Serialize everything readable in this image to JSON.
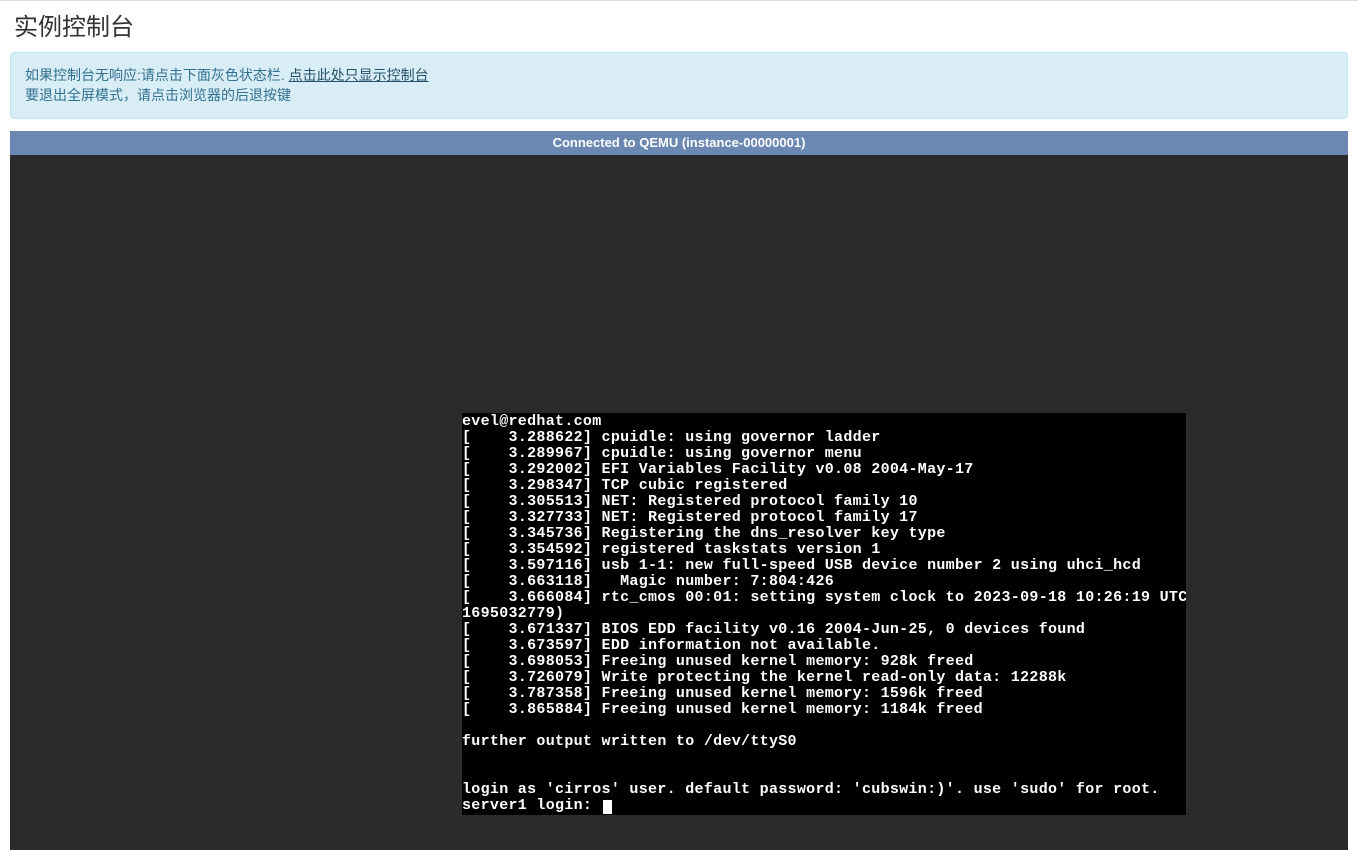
{
  "header": {
    "title": "实例控制台"
  },
  "alert": {
    "line1_pre": "如果控制台无响应:请点击下面灰色状态栏. ",
    "link": "点击此处只显示控制台",
    "line2": "要退出全屏模式，请点击浏览器的后退按键"
  },
  "status_bar": {
    "text": "Connected to QEMU (instance-00000001)"
  },
  "terminal": {
    "lines": [
      "evel@redhat.com",
      "[    3.288622] cpuidle: using governor ladder",
      "[    3.289967] cpuidle: using governor menu",
      "[    3.292002] EFI Variables Facility v0.08 2004-May-17",
      "[    3.298347] TCP cubic registered",
      "[    3.305513] NET: Registered protocol family 10",
      "[    3.327733] NET: Registered protocol family 17",
      "[    3.345736] Registering the dns_resolver key type",
      "[    3.354592] registered taskstats version 1",
      "[    3.597116] usb 1-1: new full-speed USB device number 2 using uhci_hcd",
      "[    3.663118]   Magic number: 7:804:426",
      "[    3.666084] rtc_cmos 00:01: setting system clock to 2023-09-18 10:26:19 UTC (",
      "1695032779)",
      "[    3.671337] BIOS EDD facility v0.16 2004-Jun-25, 0 devices found",
      "[    3.673597] EDD information not available.",
      "[    3.698053] Freeing unused kernel memory: 928k freed",
      "[    3.726079] Write protecting the kernel read-only data: 12288k",
      "[    3.787358] Freeing unused kernel memory: 1596k freed",
      "[    3.865884] Freeing unused kernel memory: 1184k freed",
      "",
      "further output written to /dev/ttyS0",
      "",
      "",
      "login as 'cirros' user. default password: 'cubswin:)'. use 'sudo' for root.",
      "server1 login: "
    ]
  }
}
